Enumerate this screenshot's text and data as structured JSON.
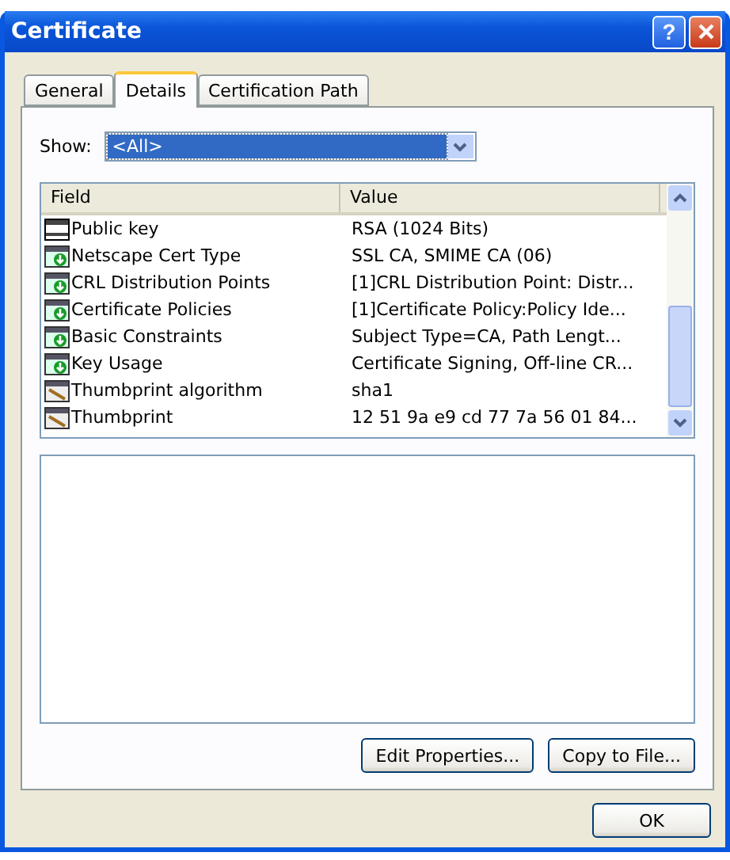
{
  "window": {
    "title": "Certificate",
    "help_button": "?"
  },
  "tabs": [
    {
      "label": "General",
      "selected": false
    },
    {
      "label": "Details",
      "selected": true
    },
    {
      "label": "Certification Path",
      "selected": false
    }
  ],
  "show": {
    "label": "Show:",
    "value": "<All>"
  },
  "table": {
    "columns": [
      "Field",
      "Value"
    ],
    "rows": [
      {
        "kind": "key",
        "field": "Public key",
        "value": "RSA (1024 Bits)"
      },
      {
        "kind": "extension",
        "field": "Netscape Cert Type",
        "value": "SSL CA, SMIME CA (06)"
      },
      {
        "kind": "extension",
        "field": "CRL Distribution Points",
        "value": "[1]CRL Distribution Point: Distr..."
      },
      {
        "kind": "extension",
        "field": "Certificate Policies",
        "value": "[1]Certificate Policy:Policy Ide..."
      },
      {
        "kind": "extension",
        "field": "Basic Constraints",
        "value": "Subject Type=CA, Path Lengt..."
      },
      {
        "kind": "extension",
        "field": "Key Usage",
        "value": "Certificate Signing, Off-line CR..."
      },
      {
        "kind": "property",
        "field": "Thumbprint algorithm",
        "value": "sha1"
      },
      {
        "kind": "property",
        "field": "Thumbprint",
        "value": "12 51 9a e9 cd 77 7a 56 01 84..."
      }
    ]
  },
  "buttons": [
    "Edit Properties...",
    "Copy to File..."
  ],
  "footer_buttons": [
    "OK"
  ]
}
